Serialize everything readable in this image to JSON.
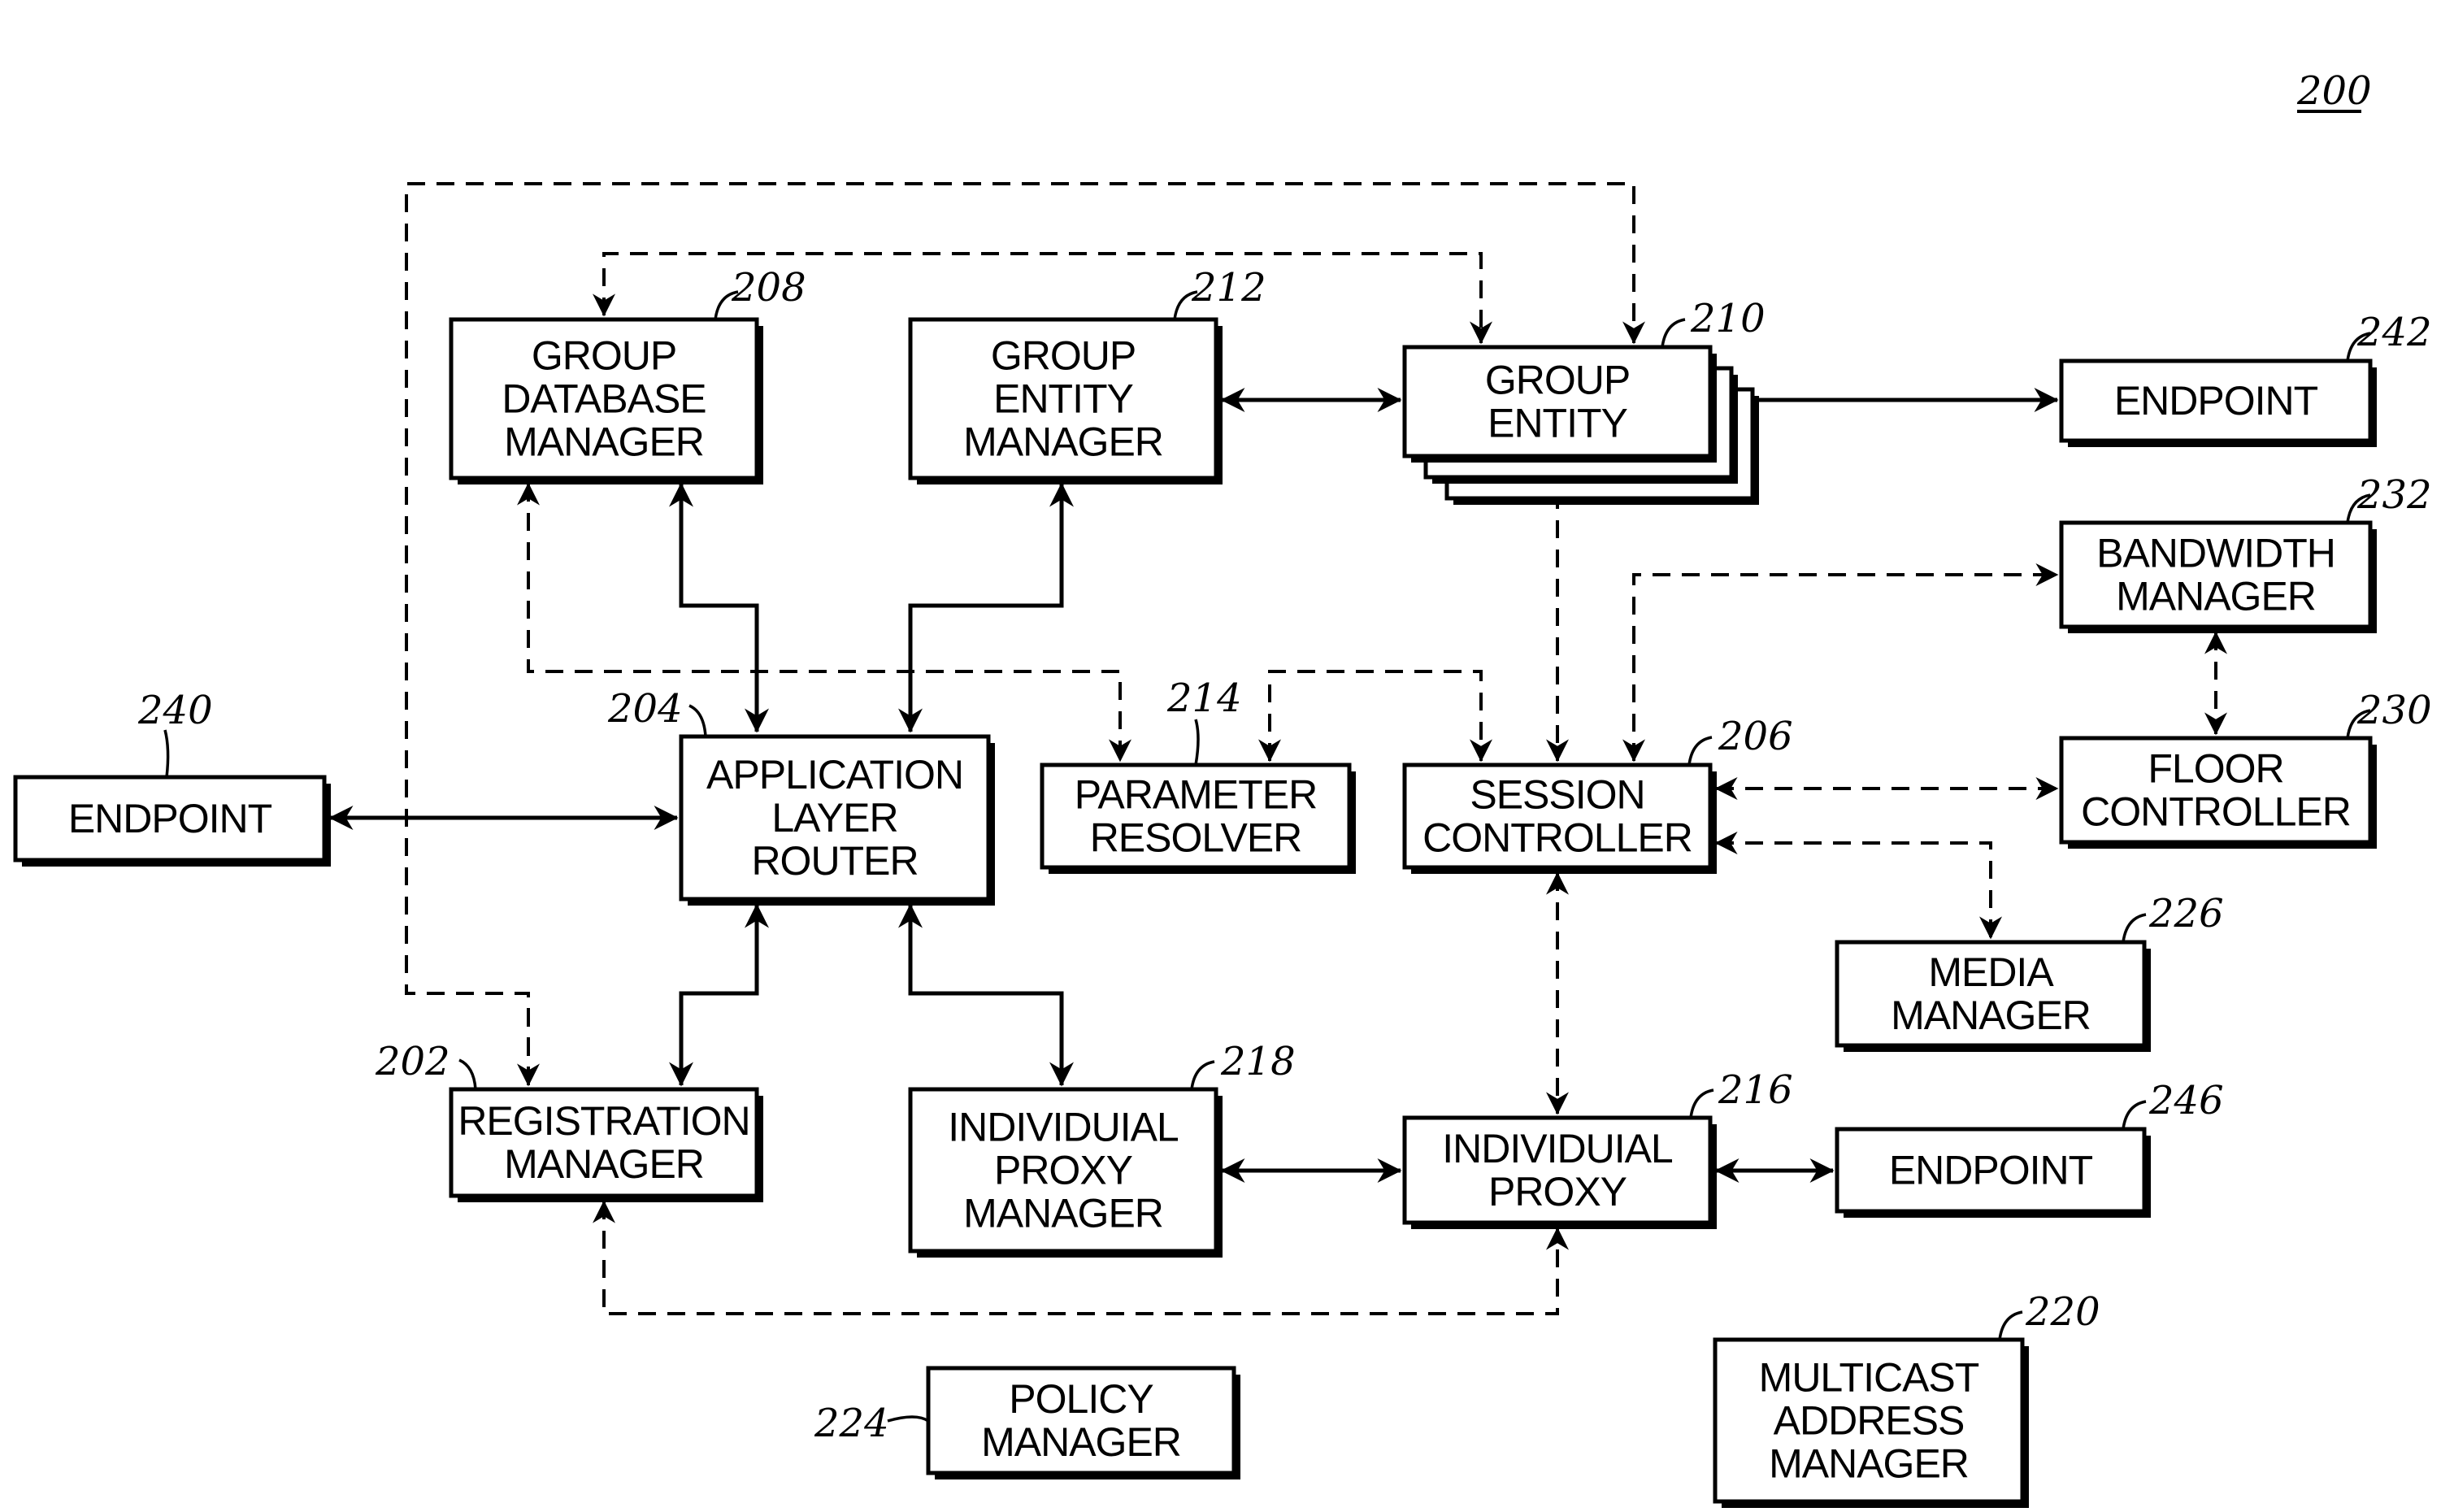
{
  "figure_number": "200",
  "colors": {
    "line": "#000000",
    "background": "#ffffff"
  },
  "blocks": {
    "group_database_manager": {
      "ref": "208",
      "lines": [
        "GROUP",
        "DATABASE",
        "MANAGER"
      ]
    },
    "group_entity_manager": {
      "ref": "212",
      "lines": [
        "GROUP",
        "ENTITY",
        "MANAGER"
      ]
    },
    "group_entity": {
      "ref": "210",
      "lines": [
        "GROUP",
        "ENTITY"
      ],
      "stacked": true
    },
    "endpoint_242": {
      "ref": "242",
      "lines": [
        "ENDPOINT"
      ]
    },
    "bandwidth_manager": {
      "ref": "232",
      "lines": [
        "BANDWIDTH",
        "MANAGER"
      ]
    },
    "floor_controller": {
      "ref": "230",
      "lines": [
        "FLOOR",
        "CONTROLLER"
      ]
    },
    "endpoint_240": {
      "ref": "240",
      "lines": [
        "ENDPOINT"
      ]
    },
    "application_layer_router": {
      "ref": "204",
      "lines": [
        "APPLICATION",
        "LAYER",
        "ROUTER"
      ]
    },
    "parameter_resolver": {
      "ref": "214",
      "lines": [
        "PARAMETER",
        "RESOLVER"
      ]
    },
    "session_controller": {
      "ref": "206",
      "lines": [
        "SESSION",
        "CONTROLLER"
      ]
    },
    "media_manager": {
      "ref": "226",
      "lines": [
        "MEDIA",
        "MANAGER"
      ]
    },
    "registration_manager": {
      "ref": "202",
      "lines": [
        "REGISTRATION",
        "MANAGER"
      ]
    },
    "individual_proxy_manager": {
      "ref": "218",
      "lines": [
        "INDIVIDUIAL",
        "PROXY",
        "MANAGER"
      ]
    },
    "individual_proxy": {
      "ref": "216",
      "lines": [
        "INDIVIDUIAL",
        "PROXY"
      ]
    },
    "endpoint_246": {
      "ref": "246",
      "lines": [
        "ENDPOINT"
      ]
    },
    "policy_manager": {
      "ref": "224",
      "lines": [
        "POLICY",
        "MANAGER"
      ]
    },
    "multicast_address_manager": {
      "ref": "220",
      "lines": [
        "MULTICAST",
        "ADDRESS",
        "MANAGER"
      ]
    }
  },
  "connections": [
    {
      "from": "endpoint_240",
      "to": "application_layer_router",
      "style": "solid",
      "direction": "bidirectional"
    },
    {
      "from": "application_layer_router",
      "to": "group_database_manager",
      "style": "solid",
      "direction": "bidirectional"
    },
    {
      "from": "application_layer_router",
      "to": "group_entity_manager",
      "style": "solid",
      "direction": "bidirectional"
    },
    {
      "from": "application_layer_router",
      "to": "registration_manager",
      "style": "solid",
      "direction": "bidirectional"
    },
    {
      "from": "application_layer_router",
      "to": "individual_proxy_manager",
      "style": "solid",
      "direction": "bidirectional"
    },
    {
      "from": "group_entity_manager",
      "to": "group_entity",
      "style": "solid",
      "direction": "bidirectional"
    },
    {
      "from": "group_entity",
      "to": "endpoint_242",
      "style": "solid",
      "direction": "bidirectional"
    },
    {
      "from": "individual_proxy_manager",
      "to": "individual_proxy",
      "style": "solid",
      "direction": "bidirectional"
    },
    {
      "from": "individual_proxy",
      "to": "endpoint_246",
      "style": "solid",
      "direction": "bidirectional"
    },
    {
      "from": "group_database_manager",
      "to": "group_entity",
      "style": "dashed",
      "direction": "bidirectional"
    },
    {
      "from": "registration_manager",
      "to": "group_entity",
      "style": "dashed",
      "direction": "bidirectional"
    },
    {
      "from": "group_database_manager",
      "to": "parameter_resolver",
      "style": "dashed",
      "direction": "bidirectional"
    },
    {
      "from": "parameter_resolver",
      "to": "session_controller",
      "style": "dashed",
      "direction": "bidirectional"
    },
    {
      "from": "group_entity",
      "to": "session_controller",
      "style": "dashed",
      "direction": "bidirectional"
    },
    {
      "from": "session_controller",
      "to": "bandwidth_manager",
      "style": "dashed",
      "direction": "bidirectional"
    },
    {
      "from": "bandwidth_manager",
      "to": "floor_controller",
      "style": "dashed",
      "direction": "bidirectional"
    },
    {
      "from": "session_controller",
      "to": "floor_controller",
      "style": "dashed",
      "direction": "bidirectional"
    },
    {
      "from": "session_controller",
      "to": "media_manager",
      "style": "dashed",
      "direction": "bidirectional"
    },
    {
      "from": "session_controller",
      "to": "individual_proxy",
      "style": "dashed",
      "direction": "bidirectional"
    },
    {
      "from": "registration_manager",
      "to": "individual_proxy",
      "style": "dashed",
      "direction": "bidirectional"
    }
  ]
}
